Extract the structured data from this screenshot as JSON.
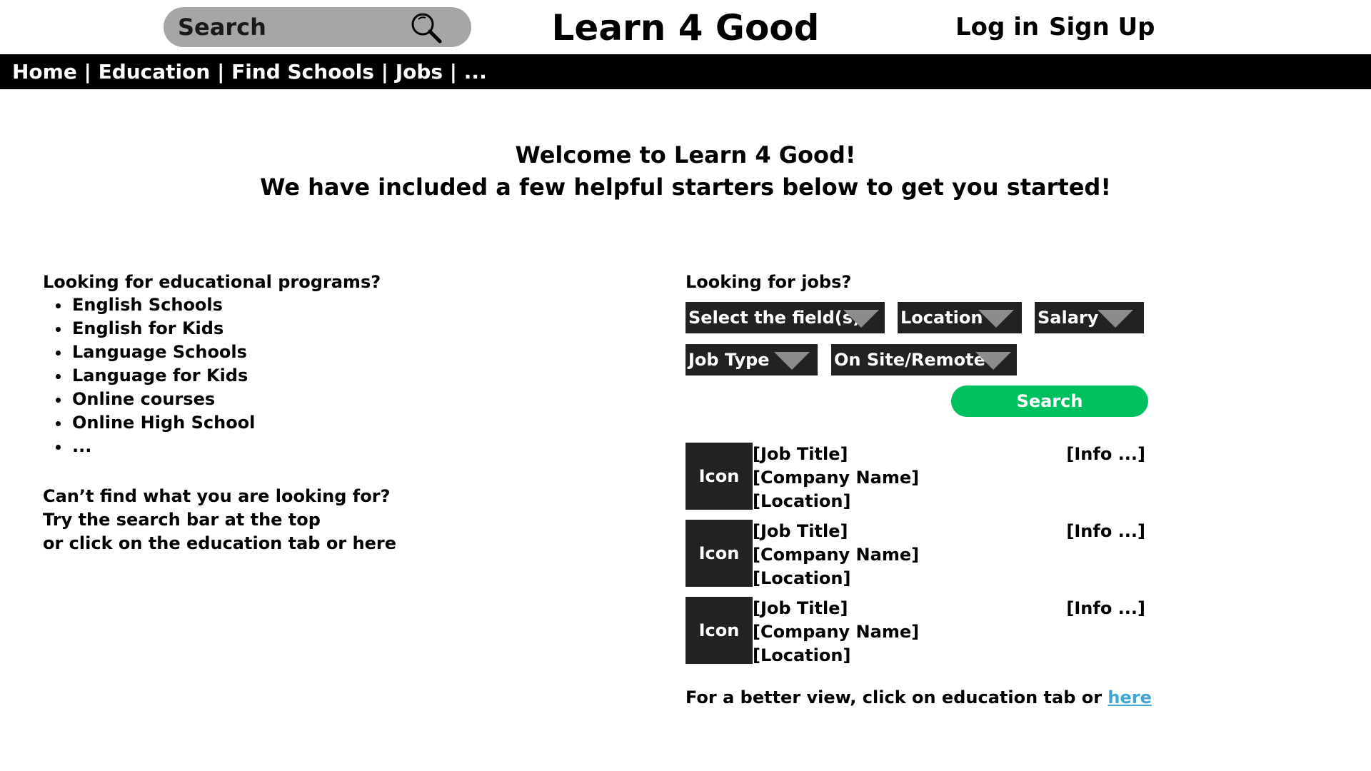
{
  "header": {
    "search_label": "Search",
    "search_icon": "magnifier-icon",
    "title": "Learn 4 Good",
    "login": "Log in",
    "signup": "Sign Up"
  },
  "nav": {
    "items": [
      "Home",
      "Education",
      "Find Schools",
      "Jobs",
      "..."
    ],
    "separator": " | "
  },
  "welcome": {
    "line1": "Welcome to Learn 4 Good!",
    "line2": "We have included a few helpful starters below to get you started!"
  },
  "education": {
    "heading": "Looking for educational programs?",
    "items": [
      "English Schools",
      "English for Kids",
      "Language Schools",
      "Language for Kids",
      "Online courses",
      "Online High School",
      "..."
    ],
    "help": [
      "Can’t find what you are looking for?",
      "Try the search bar at the top",
      "or click on the education tab or here"
    ]
  },
  "jobs": {
    "heading": "Looking for jobs?",
    "filters": {
      "field": "Select the field(s)",
      "location": "Location",
      "salary": "Salary",
      "job_type": "Job Type",
      "onsite": "On Site/Remote"
    },
    "search_button": "Search",
    "listings": [
      {
        "icon": "Icon",
        "title": "[Job Title]",
        "company": "[Company Name]",
        "location": "[Location]",
        "info": "[Info ...]"
      },
      {
        "icon": "Icon",
        "title": "[Job Title]",
        "company": "[Company Name]",
        "location": "[Location]",
        "info": "[Info ...]"
      },
      {
        "icon": "Icon",
        "title": "[Job Title]",
        "company": "[Company Name]",
        "location": "[Location]",
        "info": "[Info ...]"
      }
    ],
    "footer_text": "For a better view, click on education tab or ",
    "footer_link": "here"
  },
  "colors": {
    "nav_bg": "#000000",
    "dropdown_bg": "#222222",
    "search_button": "#00c060",
    "link": "#3fa6d6",
    "search_pill": "#a6a6a6"
  }
}
